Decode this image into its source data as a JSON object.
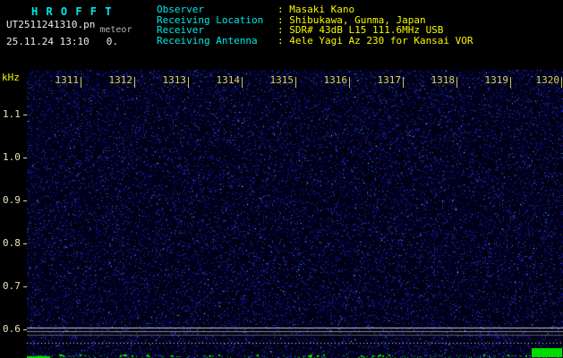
{
  "header": {
    "title": "H R O F F T",
    "filename": "UT2511241310.pn",
    "mode_label": "meteor",
    "datetime": "25.11.24 13:10",
    "counter": "0.",
    "info_rows": [
      {
        "label": "Observer",
        "value": ": Masaki Kano"
      },
      {
        "label": "Receiving Location",
        "value": ": Shibukawa, Gunma, Japan"
      },
      {
        "label": "Receiver",
        "value": ": SDR# 43dB L15 111.6MHz USB"
      },
      {
        "label": "Receiving Antenna",
        "value": ": 4ele Yagi Az 230 for Kansai VOR"
      }
    ]
  },
  "chart_data": {
    "type": "heatmap",
    "title": "HROFFT radio meteor echo spectrogram, 10-minute waterfall starting 25.11.24 13:10 UT",
    "ylabel": "kHz",
    "y_tick_labels": [
      "1.1",
      "1.0",
      "0.9",
      "0.8",
      "0.7",
      "0.6"
    ],
    "y_range_khz": [
      0.55,
      1.2
    ],
    "x_tick_labels": [
      "1311",
      "1312",
      "1313",
      "1314",
      "1315",
      "1316",
      "1317",
      "1318",
      "1319",
      "1320"
    ],
    "x_axis": "time (UT, hhmm, one tick per minute)",
    "grid": false,
    "legend": "none",
    "content": "uniform blue background noise only; no meteor echoes; faint horizontal carrier lines near 0.6 kHz; green signal-level meter strip along the bottom edge"
  },
  "colors": {
    "background": "#000000",
    "spectrogram_bg": "#000014",
    "noise_blue": "#2424b4",
    "noise_cyan_speck": "#00bce0",
    "label_cyan": "#00e8e8",
    "value_yellow": "#f8f800",
    "axis_tick_yellow": "#d8d855",
    "carrier_line_gray": "#c8c8c8",
    "meter_green": "#00dd00",
    "header_white": "#ededed"
  }
}
